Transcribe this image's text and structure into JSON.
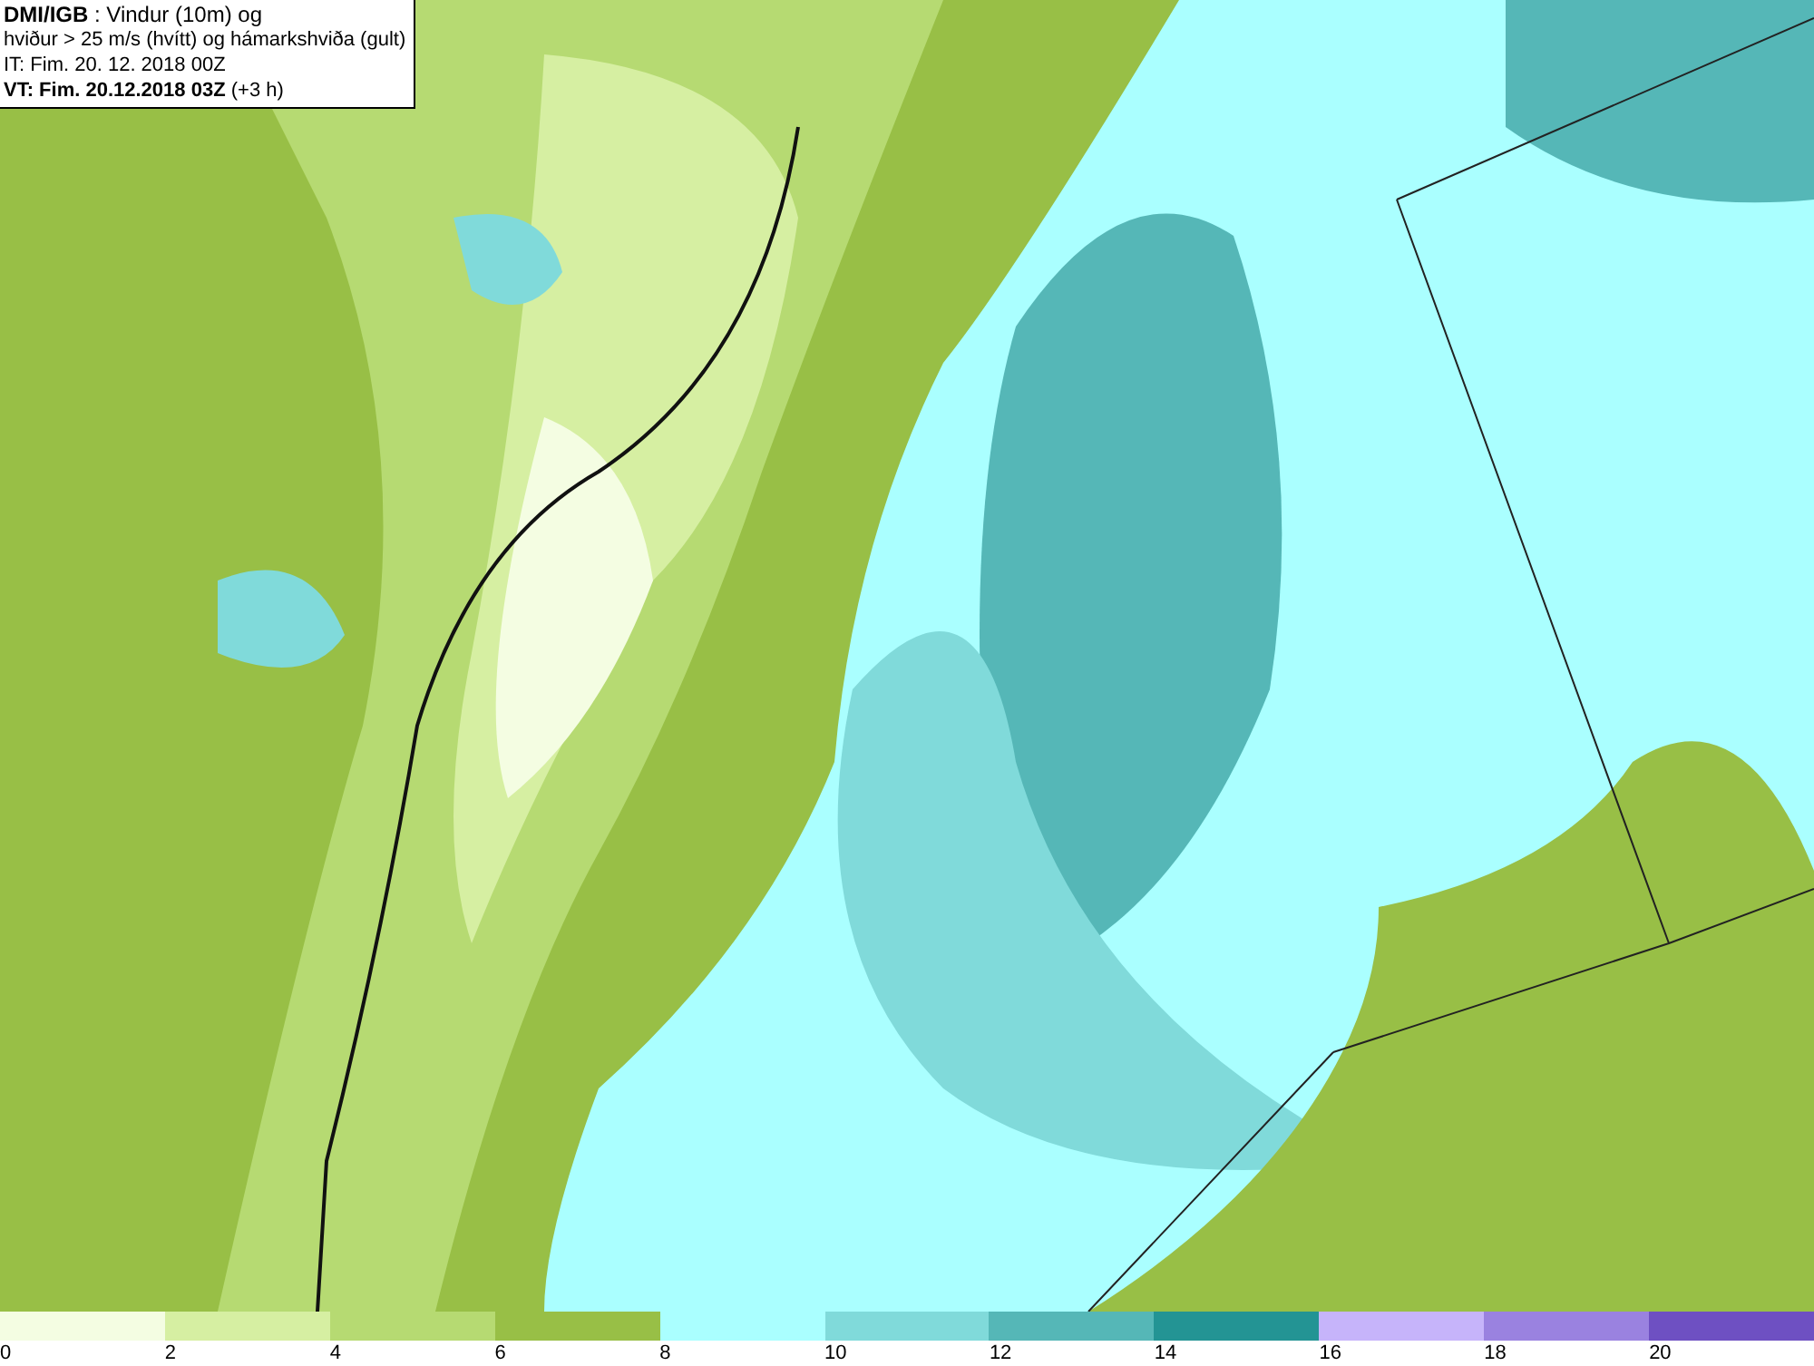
{
  "caption": {
    "lines": [
      "**DMI/IGB** : Vindur (10m) og",
      "hviður > 25 m/s (hvítt) og hámarkshviða (gult)",
      "IT: Fim. 20. 12. 2018 00Z",
      "**VT: Fim. 20.12.2018 03Z** (+3 h)"
    ]
  },
  "legend": [
    {
      "label": "0",
      "color": "#f4fde2"
    },
    {
      "label": "2",
      "color": "#d6efa2"
    },
    {
      "label": "4",
      "color": "#b6da72"
    },
    {
      "label": "6",
      "color": "#98bf46"
    },
    {
      "label": "8",
      "color": "#aaffff"
    },
    {
      "label": "10",
      "color": "#80dada"
    },
    {
      "label": "12",
      "color": "#55b7b7"
    },
    {
      "label": "14",
      "color": "#239494"
    },
    {
      "label": "16",
      "color": "#c6b4fa"
    },
    {
      "label": "18",
      "color": "#9a82e0"
    },
    {
      "label": "20",
      "color": "#6e50c2"
    }
  ]
}
